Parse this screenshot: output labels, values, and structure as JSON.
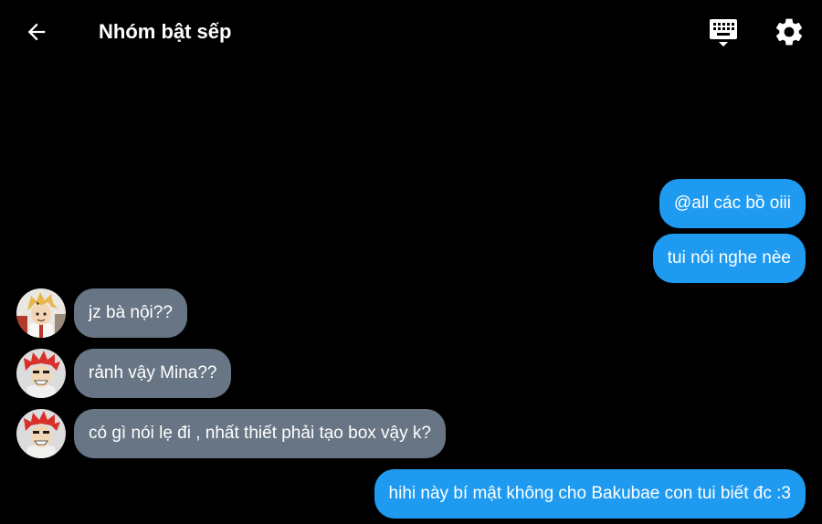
{
  "header": {
    "title": "Nhóm bật sếp",
    "back_icon": "arrow-left-icon",
    "keyboard_icon": "keyboard-icon",
    "settings_icon": "gear-icon"
  },
  "colors": {
    "background": "#000000",
    "outgoing_bubble": "#1e9bf0",
    "incoming_bubble": "#687584",
    "text": "#ffffff"
  },
  "messages": [
    {
      "direction": "out",
      "text": "@all các bồ oiii"
    },
    {
      "direction": "out",
      "text": "tui nói nghe nèe"
    },
    {
      "direction": "in",
      "avatar": "blonde-avatar",
      "text": "jz bà nội??"
    },
    {
      "direction": "in",
      "avatar": "redhead-avatar",
      "text": "rảnh vậy Mina??"
    },
    {
      "direction": "in",
      "avatar": "redhead-avatar",
      "text": "có gì nói lẹ đi , nhất thiết phải tạo box vậy k?"
    },
    {
      "direction": "out",
      "text": "hihi này bí mật không cho Bakubae con tui biết đc :3"
    }
  ]
}
